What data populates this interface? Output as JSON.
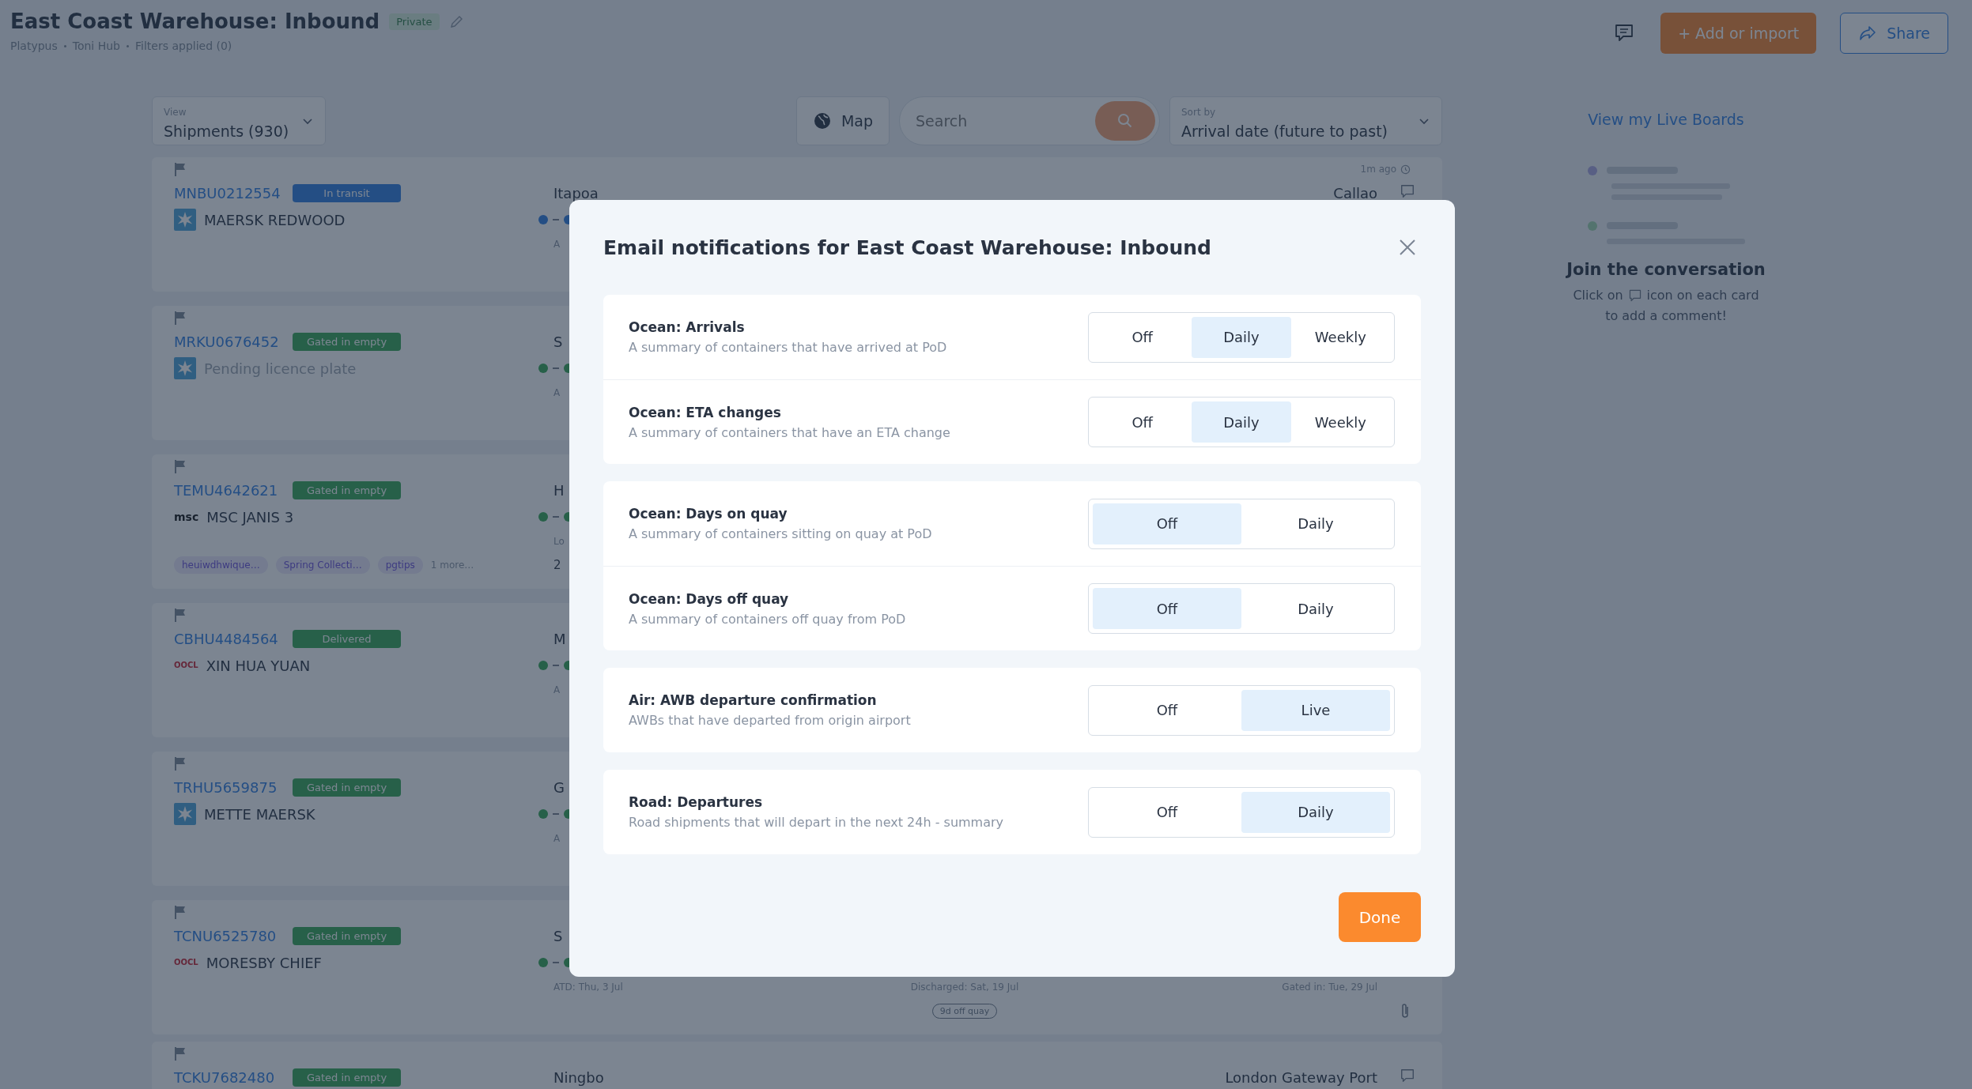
{
  "header": {
    "title": "East Coast Warehouse: Inbound",
    "badge": "Private",
    "breadcrumbs": [
      "Platypus",
      "Toni Hub",
      "Filters applied (0)"
    ],
    "add_button": "+ Add or import",
    "share_button": "Share"
  },
  "toolbar": {
    "view": {
      "label": "View",
      "value": "Shipments (930)"
    },
    "map_button": "Map",
    "search": {
      "placeholder": "Search"
    },
    "sort": {
      "label": "Sort by",
      "value": "Arrival date (future to past)"
    }
  },
  "cards": [
    {
      "id": "MNBU0212554",
      "status": {
        "label": "In transit",
        "kind": "transit"
      },
      "carrier": {
        "kind": "star"
      },
      "vessel": "MAERSK REDWOOD",
      "pending": false,
      "updated": "1m ago",
      "origin": "Itapoa",
      "destination": "Callao",
      "progress": true,
      "departure": "A",
      "comment_button": true
    },
    {
      "id": "MRKU0676452",
      "status": {
        "label": "Gated in empty",
        "kind": "done"
      },
      "carrier": {
        "kind": "star"
      },
      "vessel": "Pending licence plate",
      "pending": true,
      "origin": "S",
      "progress": true,
      "departure": "A"
    },
    {
      "id": "TEMU4642621",
      "status": {
        "label": "Gated in empty",
        "kind": "done"
      },
      "carrier": {
        "kind": "mono",
        "text": "msc"
      },
      "vessel": "MSC JANIS 3",
      "pending": false,
      "tags": [
        "heuiwdhwique…",
        "Spring Collecti…",
        "pgtips"
      ],
      "more": "1 more…",
      "origin": "H",
      "progress": true,
      "departure": "Lo",
      "note": "2"
    },
    {
      "id": "CBHU4484564",
      "status": {
        "label": "Delivered",
        "kind": "done"
      },
      "carrier": {
        "kind": "red",
        "text": "OOCL"
      },
      "vessel": "XIN HUA YUAN",
      "pending": false,
      "origin": "M",
      "progress": true,
      "departure": "A"
    },
    {
      "id": "TRHU5659875",
      "status": {
        "label": "Gated in empty",
        "kind": "done"
      },
      "carrier": {
        "kind": "star"
      },
      "vessel": "METTE MAERSK",
      "pending": false,
      "origin": "G",
      "progress": true,
      "departure": "A"
    },
    {
      "id": "TCNU6525780",
      "status": {
        "label": "Gated in empty",
        "kind": "done"
      },
      "carrier": {
        "kind": "red",
        "text": "OOCL"
      },
      "vessel": "MORESBY CHIEF",
      "pending": false,
      "origin": "S",
      "progress": true,
      "departure": "ATD: Thu, 3 Jul",
      "discharge": "Discharged: Sat, 19 Jul",
      "arrival": "Gated in: Tue, 29 Jul",
      "quay_tag": "9d off quay",
      "attachment": true
    },
    {
      "id": "TCKU7682480",
      "status": {
        "label": "Gated in empty",
        "kind": "done"
      },
      "origin": "Ningbo",
      "destination": "London Gateway Port",
      "comment_button": true
    }
  ],
  "side": {
    "link": "View my Live Boards",
    "heading": "Join the conversation",
    "hint_before": "Click on",
    "hint_after": "icon on each card",
    "hint_line2": "to add a comment!"
  },
  "modal": {
    "title": "Email notifications for East Coast Warehouse: Inbound",
    "groups": [
      {
        "rows": [
          {
            "title": "Ocean: Arrivals",
            "description": "A summary of containers that have arrived at PoD",
            "options": [
              {
                "label": "Off",
                "selected": false
              },
              {
                "label": "Daily",
                "selected": true
              },
              {
                "label": "Weekly",
                "selected": false
              }
            ]
          },
          {
            "title": "Ocean: ETA changes",
            "description": "A summary of containers that have an ETA change",
            "options": [
              {
                "label": "Off",
                "selected": false
              },
              {
                "label": "Daily",
                "selected": true
              },
              {
                "label": "Weekly",
                "selected": false
              }
            ]
          }
        ]
      },
      {
        "rows": [
          {
            "title": "Ocean: Days on quay",
            "description": "A summary of containers sitting on quay at PoD",
            "options": [
              {
                "label": "Off",
                "selected": true
              },
              {
                "label": "Daily",
                "selected": false
              }
            ]
          },
          {
            "title": "Ocean: Days off quay",
            "description": "A summary of containers off quay from PoD",
            "options": [
              {
                "label": "Off",
                "selected": true
              },
              {
                "label": "Daily",
                "selected": false
              }
            ]
          }
        ]
      },
      {
        "rows": [
          {
            "title": "Air: AWB departure confirmation",
            "description": "AWBs that have departed from origin airport",
            "options": [
              {
                "label": "Off",
                "selected": false
              },
              {
                "label": "Live",
                "selected": true
              }
            ]
          }
        ]
      },
      {
        "rows": [
          {
            "title": "Road: Departures",
            "description": "Road shipments that will depart in the next 24h - summary",
            "options": [
              {
                "label": "Off",
                "selected": false
              },
              {
                "label": "Daily",
                "selected": true
              }
            ]
          }
        ]
      }
    ],
    "done_button": "Done"
  }
}
